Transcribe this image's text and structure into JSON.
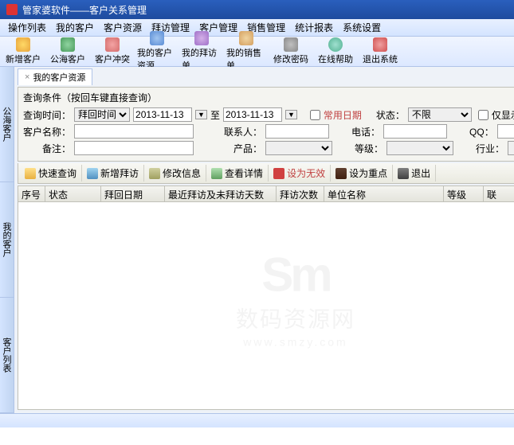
{
  "title": "管家婆软件——客户关系管理",
  "menubar": [
    "操作列表",
    "我的客户",
    "客户资源",
    "拜访管理",
    "客户管理",
    "销售管理",
    "统计报表",
    "系统设置"
  ],
  "toolbar": [
    {
      "label": "新增客户"
    },
    {
      "label": "公海客户"
    },
    {
      "label": "客户冲突"
    },
    {
      "label": "我的客户资源"
    },
    {
      "label": "我的拜访单"
    },
    {
      "label": "我的销售单"
    },
    {
      "label": "修改密码"
    },
    {
      "label": "在线帮助"
    },
    {
      "label": "退出系统"
    }
  ],
  "sidetabs": [
    "公海客户",
    "我的客户",
    "客户列表"
  ],
  "doctab": {
    "close": "×",
    "label": "我的客户资源"
  },
  "search": {
    "panel_title": "查询条件（按回车键直接查询）",
    "lbl_time": "查询时间：",
    "time_mode": "拜回时间",
    "date_from": "2013-11-13",
    "date_to_sep": "至",
    "date_to": "2013-11-13",
    "chk_common_label": "常用日期",
    "lbl_status": "状态：",
    "status_val": "不限",
    "chk_only_unvisited": "仅显示未拜访客户",
    "lbl_name": "客户名称：",
    "lbl_contact": "联系人：",
    "lbl_phone": "电话：",
    "lbl_qq": "QQ：",
    "lbl_remark": "备注：",
    "lbl_product": "产品：",
    "lbl_level": "等级：",
    "lbl_industry": "行业："
  },
  "actions": {
    "quick_search": "快速查询",
    "add_visit": "新增拜访",
    "edit_info": "修改信息",
    "view_detail": "查看详情",
    "set_void": "设为无效",
    "set_key": "设为重点",
    "exit": "退出"
  },
  "grid_headers": [
    "序号",
    "状态",
    "拜回日期",
    "最近拜访及未拜访天数",
    "拜访次数",
    "单位名称",
    "等级",
    "联"
  ],
  "watermark": {
    "logo": "Sm",
    "text": "数码资源网",
    "url": "www.smzy.com"
  },
  "statusbar": {
    "left": "",
    "right": ""
  }
}
